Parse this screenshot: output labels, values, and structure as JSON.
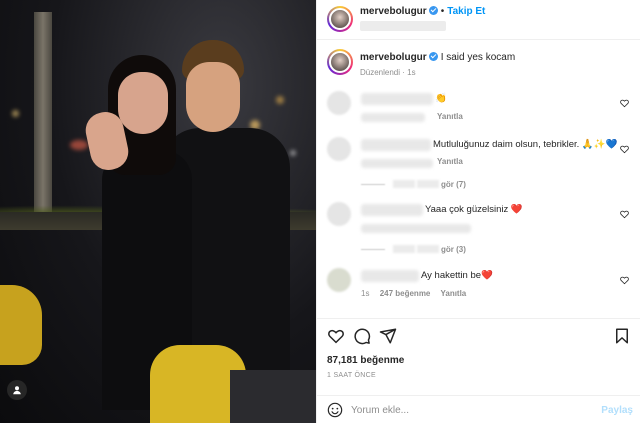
{
  "post": {
    "username": "mervebolugur",
    "follow_label": "Takip Et",
    "separator": "•"
  },
  "caption": {
    "username": "mervebolugur",
    "text": "I said yes kocam",
    "edited": "Düzenlendi",
    "time": "1s"
  },
  "comments": [
    {
      "text": "👏",
      "reply": "Yanıtla"
    },
    {
      "text": "Mutluluğunuz daim olsun, tebrikler. 🙏✨💙",
      "reply": "Yanıtla",
      "view_replies": "gör (7)"
    },
    {
      "text": "Yaaa çok güzelsiniz ❤️",
      "view_replies": "gör (3)"
    },
    {
      "text": "Ay hakettin be❤️",
      "time": "1s",
      "likes": "247 beğenme",
      "reply": "Yanıtla"
    }
  ],
  "actions": {
    "like_count": "87,181 beğenme",
    "timestamp": "1 SAAT ÖNCE"
  },
  "composer": {
    "placeholder": "Yorum ekle...",
    "post_label": "Paylaş"
  },
  "colors": {
    "link": "#0095f6",
    "verified": "#3897f0",
    "muted": "#8e8e8e",
    "post_disabled": "#b2dffc"
  }
}
